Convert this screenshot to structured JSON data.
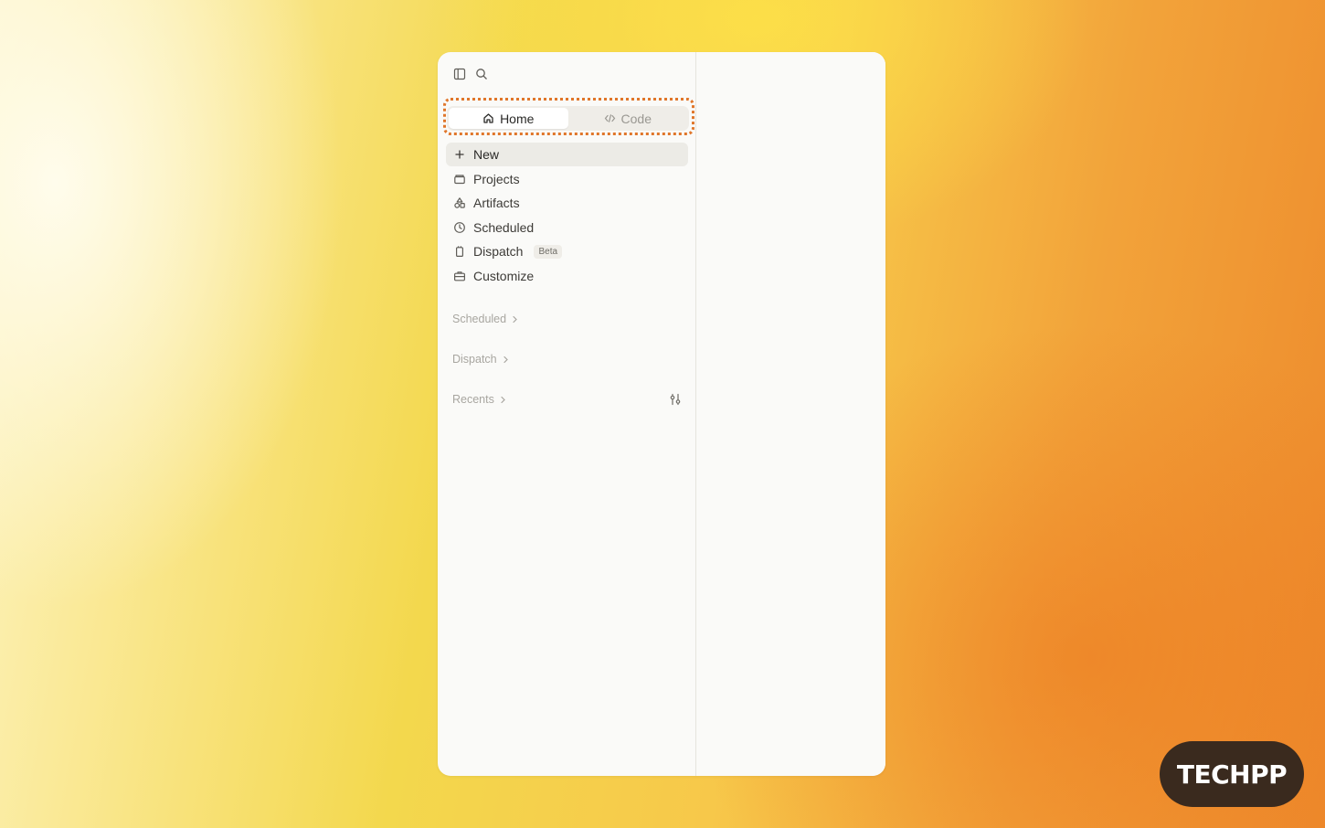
{
  "toolbar": {
    "sidebar_toggle_icon": "sidebar-panel-icon",
    "search_icon": "search-icon"
  },
  "mode_switch": {
    "tabs": [
      {
        "label": "Home",
        "icon": "home-icon",
        "active": true
      },
      {
        "label": "Code",
        "icon": "code-icon",
        "active": false
      }
    ],
    "highlight_color": "#e0762a"
  },
  "nav": {
    "items": [
      {
        "label": "New",
        "icon": "plus-icon",
        "selected": true
      },
      {
        "label": "Projects",
        "icon": "folder-icon"
      },
      {
        "label": "Artifacts",
        "icon": "shapes-icon"
      },
      {
        "label": "Scheduled",
        "icon": "clock-icon"
      },
      {
        "label": "Dispatch",
        "icon": "phone-icon",
        "badge": "Beta"
      },
      {
        "label": "Customize",
        "icon": "briefcase-icon"
      }
    ]
  },
  "sections": {
    "scheduled": "Scheduled",
    "dispatch": "Dispatch",
    "recents": "Recents"
  },
  "watermark": {
    "text": "TECHPP"
  },
  "colors": {
    "window_bg": "#fafaf8",
    "selected_bg": "#ecebe6",
    "watermark_bg": "#3a2a1e"
  }
}
